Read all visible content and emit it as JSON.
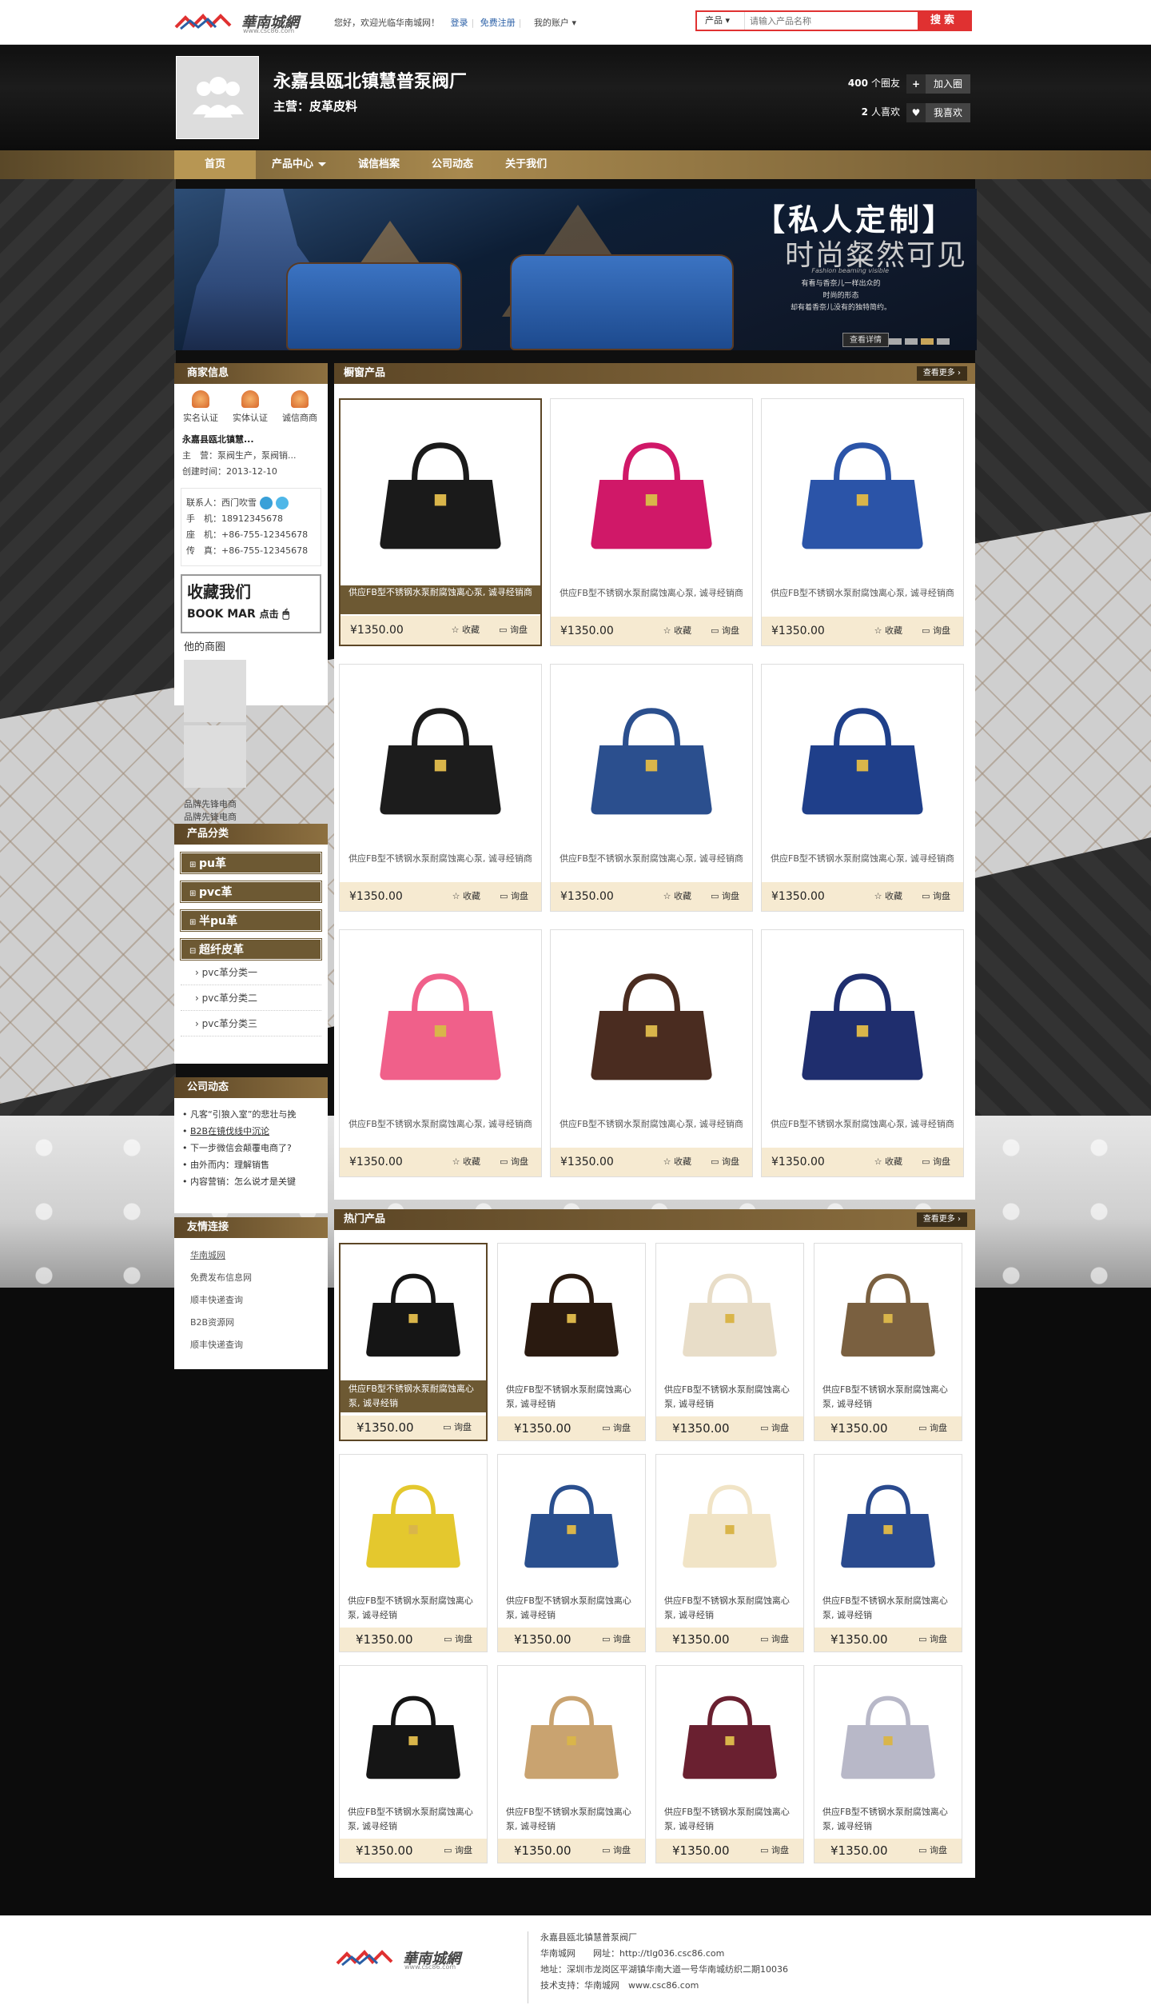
{
  "topbar": {
    "logo_name": "華南城網",
    "logo_url": "www.csc86.com",
    "welcome": "您好，欢迎光临华南城网！",
    "login": "登录",
    "register": "免费注册",
    "account": "我的账户",
    "search_category": "产品",
    "search_placeholder": "请输入产品名称",
    "search_button": "搜索"
  },
  "header": {
    "company": "永嘉县瓯北镇慧普泵阀厂",
    "main_business": "主营：皮革皮料",
    "fans_count": "400",
    "fans_label": "个圈友",
    "join_button": "加入圈",
    "likes_count": "2",
    "likes_label": "人喜欢",
    "like_button": "我喜欢"
  },
  "nav": {
    "items": [
      "首页",
      "产品中心",
      "诚信档案",
      "公司动态",
      "关于我们"
    ],
    "active": "首页"
  },
  "banner": {
    "title": "【私人定制】",
    "subtitle": "时尚粲然可见",
    "english": "Fashion beaming visible",
    "copy_line1": "有看与香奈儿一样出众的",
    "copy_line2": "时尚的形态",
    "copy_line3": "却有着香奈儿没有的独特简约。",
    "more": "查看详情"
  },
  "merchant": {
    "title": "商家信息",
    "badges": [
      "实名认证",
      "实体认证",
      "诚信商商"
    ],
    "name": "永嘉县瓯北镇慧...",
    "main_label": "主　营：",
    "main_value": "泵阀生产，泵阀销...",
    "created_label": "创建时间：",
    "created_value": "2013-12-10",
    "contact_label": "联系人：",
    "contact_value": "西门吹雪",
    "phone_label": "手　机：",
    "phone_value": "18912345678",
    "tel_label": "座　机：",
    "tel_value": "+86-755-12345678",
    "fax_label": "传　真：",
    "fax_value": "+86-755-12345678",
    "bookmark_line1": "收藏我们",
    "bookmark_line2": "BOOK MAR",
    "bookmark_click": "点击",
    "shops_title": "他的商圈",
    "shops": [
      "品牌先锋电商",
      "品牌先锋电商"
    ]
  },
  "categories": {
    "title": "产品分类",
    "main": [
      "pu革",
      "pvc革",
      "半pu革",
      "超纤皮革"
    ],
    "sub": [
      "pvc革分类一",
      "pvc革分类二",
      "pvc革分类三"
    ]
  },
  "news": {
    "title": "公司动态",
    "items": [
      "凡客“引狼入室”的悲壮与挽",
      "B2B在镜伐线中沉论",
      "下一步微信会颠覆电商了?",
      "由外而内：理解销售",
      "内容营销：怎么说才是关键"
    ]
  },
  "friend_links": {
    "title": "友情连接",
    "items": [
      "华南城网",
      "免费发布信息网",
      "顺丰快递查询",
      "B2B资源网",
      "顺丰快递查询"
    ]
  },
  "showcase": {
    "title": "橱窗产品",
    "more": "查看更多",
    "desc": "供应FB型不锈钢水泵耐腐蚀离心泵, 诚寻经销商",
    "price": "¥1350.00",
    "fav": "收藏",
    "ask": "询盘",
    "colors": [
      "#1a1a1a",
      "#d01868",
      "#2b54a8",
      "#1c1c1c",
      "#2b4f8e",
      "#1f3f8a",
      "#f0608a",
      "#4a2c20",
      "#1f2e6e"
    ]
  },
  "hot": {
    "title": "热门产品",
    "more": "查看更多",
    "desc": "供应FB型不锈钢水泵耐腐蚀离心泵, 诚寻经销",
    "price": "¥1350.00",
    "ask": "询盘",
    "colors": [
      "#151515",
      "#2a1a10",
      "#e8ddc8",
      "#7a6040",
      "#e4c82e",
      "#2a4f8e",
      "#f1e4c6",
      "#2a4a8e",
      "#151515",
      "#c9a370",
      "#6a2030",
      "#b8b8c8"
    ]
  },
  "footer": {
    "logo_name": "華南城網",
    "logo_url": "www.csc86.com",
    "company": "永嘉县瓯北镇慧普泵阀厂",
    "site_label": "华南城网",
    "site_url_label": "网址：",
    "site_url": "http://tlg036.csc86.com",
    "address_label": "地址：",
    "address": "深圳市龙岗区平湖镇华南大道一号华南城纺织二期10036",
    "support_label": "技术支持：",
    "support_name": "华南城网",
    "support_url": "www.csc86.com"
  }
}
